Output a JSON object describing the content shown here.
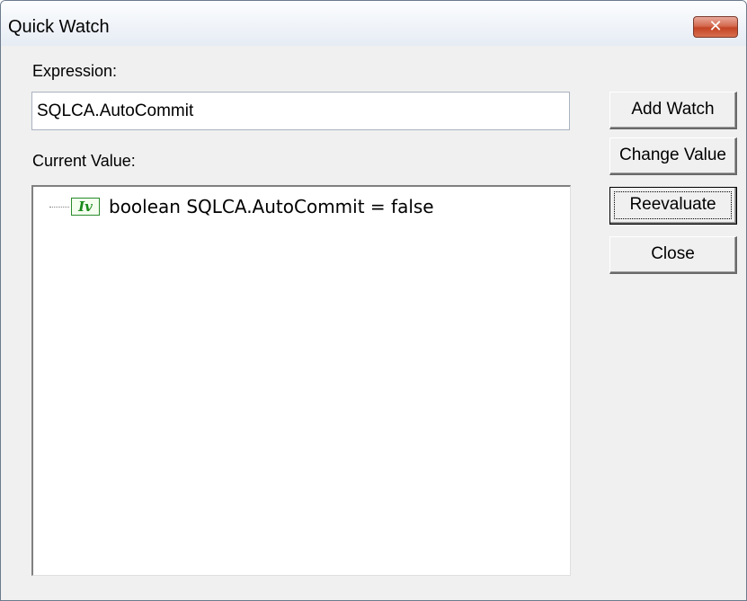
{
  "window": {
    "title": "Quick Watch",
    "close_icon": "close-icon"
  },
  "expression": {
    "label": "Expression:",
    "value": "SQLCA.AutoCommit"
  },
  "current_value": {
    "label": "Current Value:",
    "items": [
      {
        "icon": "instance-variable-icon",
        "icon_text": "Iv",
        "text": "boolean SQLCA.AutoCommit = false"
      }
    ]
  },
  "buttons": {
    "add_watch": "Add Watch",
    "change_value": "Change Value",
    "reevaluate": "Reevaluate",
    "close": "Close"
  }
}
